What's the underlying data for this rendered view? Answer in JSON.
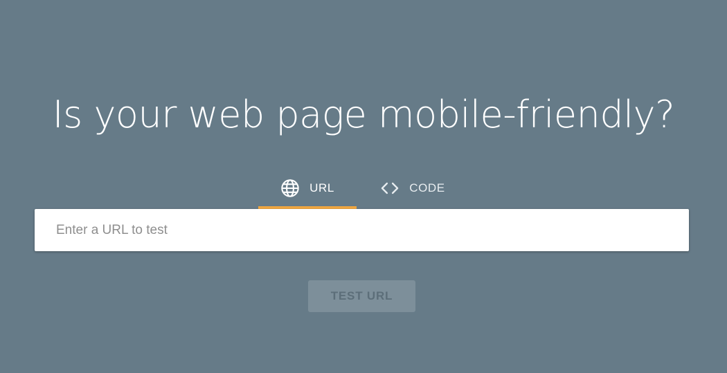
{
  "page": {
    "headline": "Is your web page mobile-friendly?",
    "background_color": "#667b88",
    "accent_color": "#f0a740"
  },
  "tabs": [
    {
      "label": "URL",
      "icon": "globe-icon",
      "selected": true
    },
    {
      "label": "CODE",
      "icon": "code-brackets-icon",
      "selected": false
    }
  ],
  "url_input": {
    "value": "",
    "placeholder": "Enter a URL to test"
  },
  "test_button": {
    "label": "TEST URL",
    "enabled": false
  }
}
